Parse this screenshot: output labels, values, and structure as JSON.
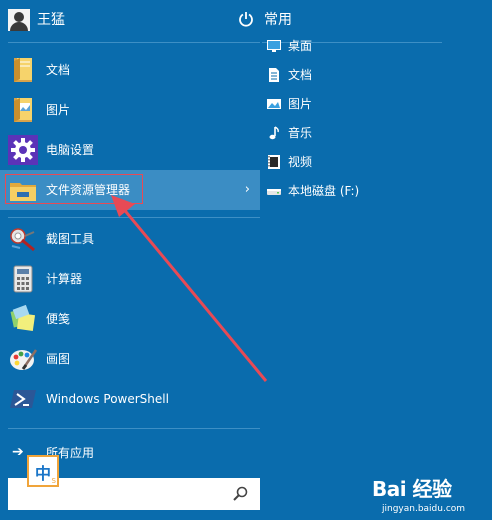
{
  "user": {
    "name": "王猛"
  },
  "power": {
    "icon": "power-icon"
  },
  "frequent_title": "常用",
  "apps": [
    {
      "label": "文档",
      "icon": "documents-folder-icon"
    },
    {
      "label": "图片",
      "icon": "pictures-folder-icon"
    },
    {
      "label": "电脑设置",
      "icon": "settings-gear-icon"
    },
    {
      "label": "文件资源管理器",
      "icon": "file-explorer-icon",
      "chevron": "›"
    },
    {
      "label": "截图工具",
      "icon": "snipping-tool-icon"
    },
    {
      "label": "计算器",
      "icon": "calculator-icon"
    },
    {
      "label": "便笺",
      "icon": "sticky-notes-icon"
    },
    {
      "label": "画图",
      "icon": "paint-icon"
    },
    {
      "label": "Windows PowerShell",
      "icon": "powershell-icon"
    }
  ],
  "all_apps_label": "所有应用",
  "places": [
    {
      "label": "桌面",
      "icon": "desktop-icon"
    },
    {
      "label": "文档",
      "icon": "document-icon"
    },
    {
      "label": "图片",
      "icon": "picture-icon"
    },
    {
      "label": "音乐",
      "icon": "music-icon"
    },
    {
      "label": "视频",
      "icon": "video-icon"
    },
    {
      "label": "本地磁盘 (F:)",
      "icon": "local-disk-icon"
    }
  ],
  "ime": {
    "char": "中",
    "sub": "S"
  },
  "watermark": {
    "logo": "Bai 经验",
    "sub": "jingyan.baidu.com"
  },
  "colors": {
    "background": "#0a6cad",
    "highlight": "#3b8dc4",
    "annotation_red": "#e84a55"
  }
}
